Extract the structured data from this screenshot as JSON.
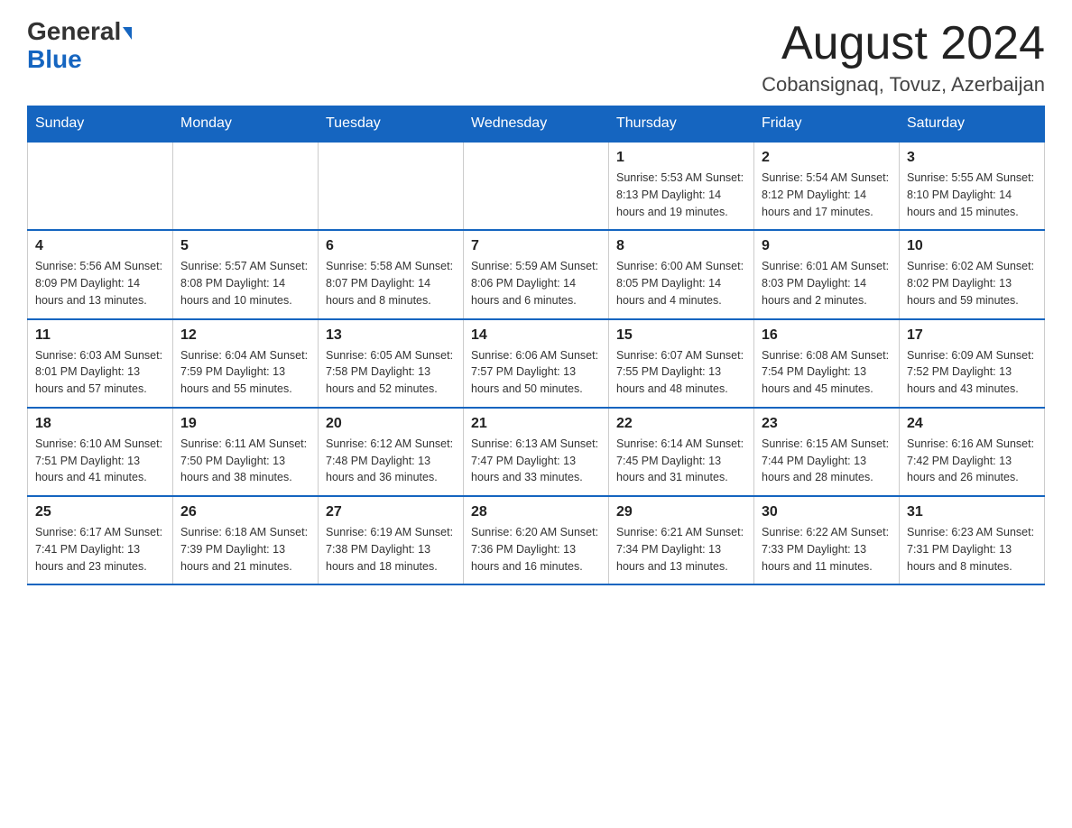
{
  "header": {
    "logo_line1": "General",
    "logo_line2": "Blue",
    "main_title": "August 2024",
    "subtitle": "Cobansignaq, Tovuz, Azerbaijan"
  },
  "days_of_week": [
    "Sunday",
    "Monday",
    "Tuesday",
    "Wednesday",
    "Thursday",
    "Friday",
    "Saturday"
  ],
  "weeks": [
    [
      {
        "day": "",
        "info": ""
      },
      {
        "day": "",
        "info": ""
      },
      {
        "day": "",
        "info": ""
      },
      {
        "day": "",
        "info": ""
      },
      {
        "day": "1",
        "info": "Sunrise: 5:53 AM\nSunset: 8:13 PM\nDaylight: 14 hours and 19 minutes."
      },
      {
        "day": "2",
        "info": "Sunrise: 5:54 AM\nSunset: 8:12 PM\nDaylight: 14 hours and 17 minutes."
      },
      {
        "day": "3",
        "info": "Sunrise: 5:55 AM\nSunset: 8:10 PM\nDaylight: 14 hours and 15 minutes."
      }
    ],
    [
      {
        "day": "4",
        "info": "Sunrise: 5:56 AM\nSunset: 8:09 PM\nDaylight: 14 hours and 13 minutes."
      },
      {
        "day": "5",
        "info": "Sunrise: 5:57 AM\nSunset: 8:08 PM\nDaylight: 14 hours and 10 minutes."
      },
      {
        "day": "6",
        "info": "Sunrise: 5:58 AM\nSunset: 8:07 PM\nDaylight: 14 hours and 8 minutes."
      },
      {
        "day": "7",
        "info": "Sunrise: 5:59 AM\nSunset: 8:06 PM\nDaylight: 14 hours and 6 minutes."
      },
      {
        "day": "8",
        "info": "Sunrise: 6:00 AM\nSunset: 8:05 PM\nDaylight: 14 hours and 4 minutes."
      },
      {
        "day": "9",
        "info": "Sunrise: 6:01 AM\nSunset: 8:03 PM\nDaylight: 14 hours and 2 minutes."
      },
      {
        "day": "10",
        "info": "Sunrise: 6:02 AM\nSunset: 8:02 PM\nDaylight: 13 hours and 59 minutes."
      }
    ],
    [
      {
        "day": "11",
        "info": "Sunrise: 6:03 AM\nSunset: 8:01 PM\nDaylight: 13 hours and 57 minutes."
      },
      {
        "day": "12",
        "info": "Sunrise: 6:04 AM\nSunset: 7:59 PM\nDaylight: 13 hours and 55 minutes."
      },
      {
        "day": "13",
        "info": "Sunrise: 6:05 AM\nSunset: 7:58 PM\nDaylight: 13 hours and 52 minutes."
      },
      {
        "day": "14",
        "info": "Sunrise: 6:06 AM\nSunset: 7:57 PM\nDaylight: 13 hours and 50 minutes."
      },
      {
        "day": "15",
        "info": "Sunrise: 6:07 AM\nSunset: 7:55 PM\nDaylight: 13 hours and 48 minutes."
      },
      {
        "day": "16",
        "info": "Sunrise: 6:08 AM\nSunset: 7:54 PM\nDaylight: 13 hours and 45 minutes."
      },
      {
        "day": "17",
        "info": "Sunrise: 6:09 AM\nSunset: 7:52 PM\nDaylight: 13 hours and 43 minutes."
      }
    ],
    [
      {
        "day": "18",
        "info": "Sunrise: 6:10 AM\nSunset: 7:51 PM\nDaylight: 13 hours and 41 minutes."
      },
      {
        "day": "19",
        "info": "Sunrise: 6:11 AM\nSunset: 7:50 PM\nDaylight: 13 hours and 38 minutes."
      },
      {
        "day": "20",
        "info": "Sunrise: 6:12 AM\nSunset: 7:48 PM\nDaylight: 13 hours and 36 minutes."
      },
      {
        "day": "21",
        "info": "Sunrise: 6:13 AM\nSunset: 7:47 PM\nDaylight: 13 hours and 33 minutes."
      },
      {
        "day": "22",
        "info": "Sunrise: 6:14 AM\nSunset: 7:45 PM\nDaylight: 13 hours and 31 minutes."
      },
      {
        "day": "23",
        "info": "Sunrise: 6:15 AM\nSunset: 7:44 PM\nDaylight: 13 hours and 28 minutes."
      },
      {
        "day": "24",
        "info": "Sunrise: 6:16 AM\nSunset: 7:42 PM\nDaylight: 13 hours and 26 minutes."
      }
    ],
    [
      {
        "day": "25",
        "info": "Sunrise: 6:17 AM\nSunset: 7:41 PM\nDaylight: 13 hours and 23 minutes."
      },
      {
        "day": "26",
        "info": "Sunrise: 6:18 AM\nSunset: 7:39 PM\nDaylight: 13 hours and 21 minutes."
      },
      {
        "day": "27",
        "info": "Sunrise: 6:19 AM\nSunset: 7:38 PM\nDaylight: 13 hours and 18 minutes."
      },
      {
        "day": "28",
        "info": "Sunrise: 6:20 AM\nSunset: 7:36 PM\nDaylight: 13 hours and 16 minutes."
      },
      {
        "day": "29",
        "info": "Sunrise: 6:21 AM\nSunset: 7:34 PM\nDaylight: 13 hours and 13 minutes."
      },
      {
        "day": "30",
        "info": "Sunrise: 6:22 AM\nSunset: 7:33 PM\nDaylight: 13 hours and 11 minutes."
      },
      {
        "day": "31",
        "info": "Sunrise: 6:23 AM\nSunset: 7:31 PM\nDaylight: 13 hours and 8 minutes."
      }
    ]
  ]
}
